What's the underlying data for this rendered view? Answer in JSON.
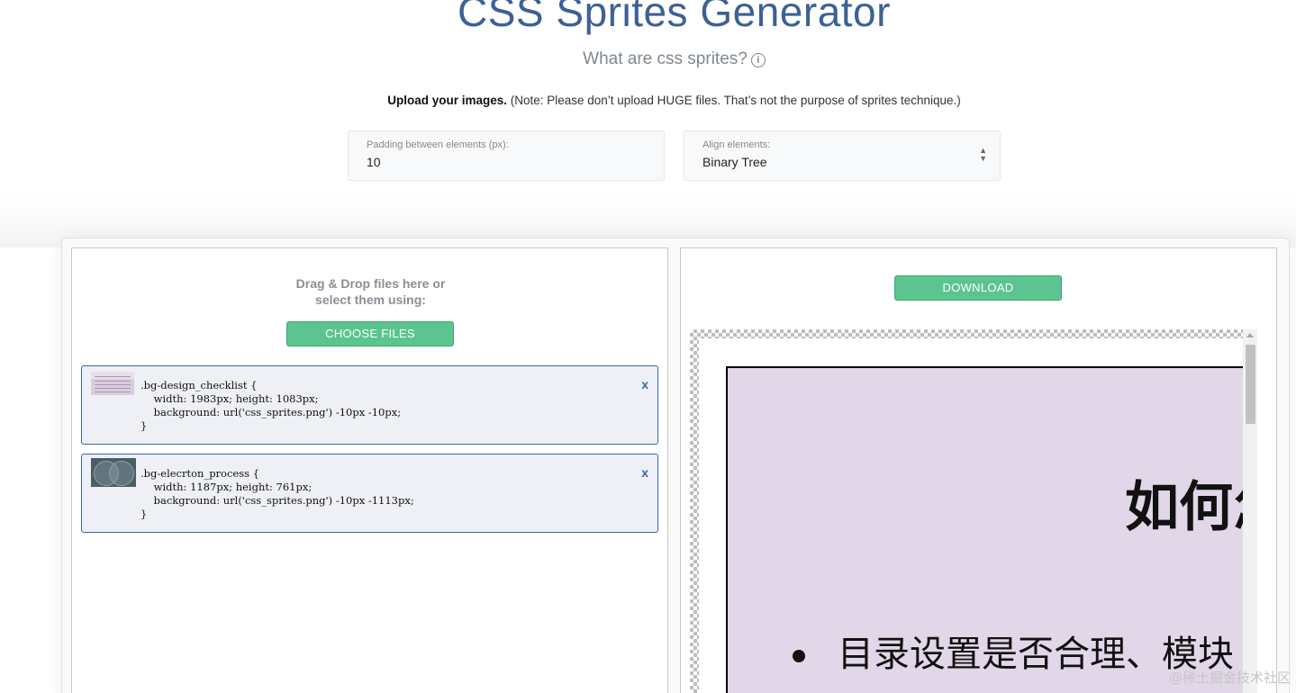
{
  "header": {
    "title": "CSS Sprites Generator",
    "subtitle": "What are css sprites?",
    "info_icon": "i"
  },
  "upload_note": {
    "bold": "Upload your images.",
    "text": " (Note: Please don’t upload HUGE files. That’s not the purpose of sprites technique.)"
  },
  "options": {
    "padding": {
      "label": "Padding between elements (px):",
      "value": "10"
    },
    "align": {
      "label": "Align elements:",
      "value": "Binary Tree",
      "arrows_icon": "select-arrows-icon"
    }
  },
  "left_panel": {
    "drop_line1": "Drag & Drop files here or",
    "drop_line2": "select them using:",
    "choose_label": "CHOOSE FILES",
    "items": [
      {
        "code": ".bg-design_checklist {\n    width: 1983px; height: 1083px;\n    background: url('css_sprites.png') -10px -10px;\n}",
        "remove": "x"
      },
      {
        "code": ".bg-elecrton_process {\n    width: 1187px; height: 761px;\n    background: url('css_sprites.png') -10px -1113px;\n}",
        "remove": "x"
      }
    ]
  },
  "right_panel": {
    "download_label": "DOWNLOAD",
    "preview_heading": "如何怎",
    "preview_bullet": "目录设置是否合理、模块"
  },
  "watermark": "@稀土掘金技术社区",
  "colors": {
    "title": "#3d6096",
    "button_green": "#5cc48e",
    "item_border": "#3a66a8",
    "item_bg": "#eef0f6",
    "sprite_bg": "#e2d7e8"
  }
}
